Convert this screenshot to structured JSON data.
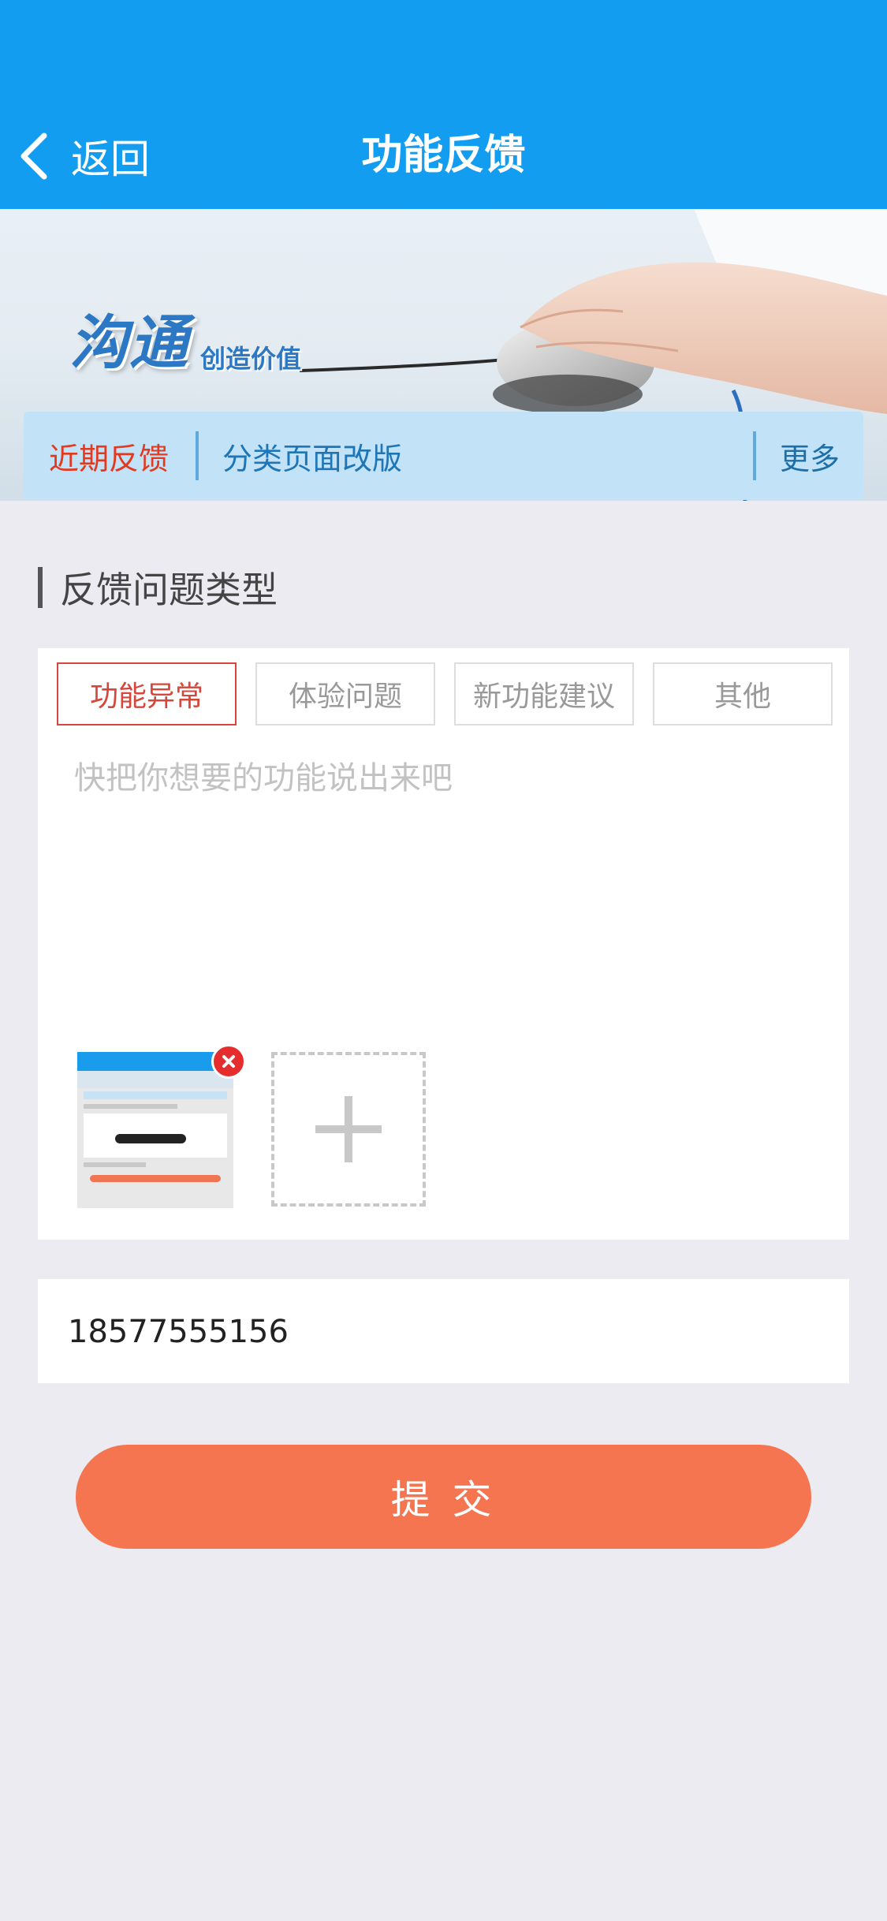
{
  "navbar": {
    "back_label": "返回",
    "title": "功能反馈",
    "bg_color": "#139df0"
  },
  "banner": {
    "slogan_main": "沟通",
    "slogan_sub": "创造价值"
  },
  "notice": {
    "tag": "近期反馈",
    "text": "分类页面改版",
    "more": "更多"
  },
  "section": {
    "title": "反馈问题类型"
  },
  "feedback_types": [
    {
      "label": "功能异常",
      "active": true
    },
    {
      "label": "体验问题",
      "active": false
    },
    {
      "label": "新功能建议",
      "active": false
    },
    {
      "label": "其他",
      "active": false
    }
  ],
  "feedback": {
    "placeholder": "快把你想要的功能说出来吧",
    "value": ""
  },
  "attachments": {
    "thumbnail_count": 1
  },
  "contact": {
    "phone": "18577555156"
  },
  "submit": {
    "label": "提  交",
    "color": "#f47550"
  }
}
